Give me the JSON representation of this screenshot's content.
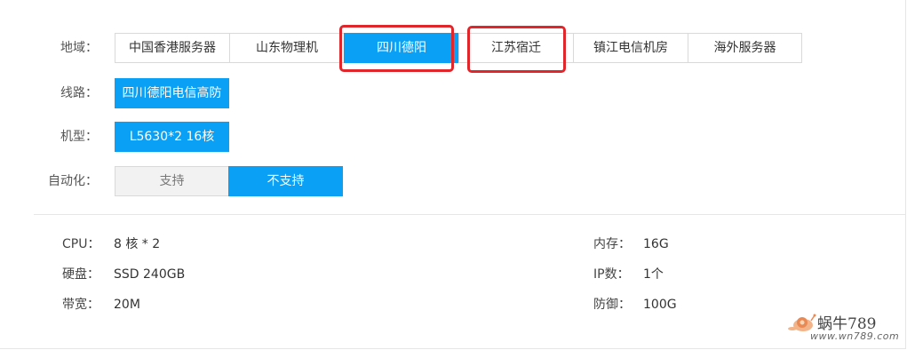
{
  "region": {
    "label": "地域：",
    "options": [
      {
        "text": "中国香港服务器",
        "state": "normal"
      },
      {
        "text": "山东物理机",
        "state": "normal"
      },
      {
        "text": "四川德阳",
        "state": "active"
      },
      {
        "text": "江苏宿迁",
        "state": "normal"
      },
      {
        "text": "镇江电信机房",
        "state": "normal"
      },
      {
        "text": "海外服务器",
        "state": "normal"
      }
    ]
  },
  "line": {
    "label": "线路：",
    "options": [
      {
        "text": "四川德阳电信高防",
        "state": "active"
      }
    ]
  },
  "model": {
    "label": "机型：",
    "options": [
      {
        "text": "L5630*2 16核",
        "state": "active"
      }
    ]
  },
  "automation": {
    "label": "自动化：",
    "options": [
      {
        "text": "支持",
        "state": "disabled"
      },
      {
        "text": "不支持",
        "state": "active"
      }
    ]
  },
  "specs": {
    "cpu_label": "CPU：",
    "cpu_value": "8 核 * 2",
    "disk_label": "硬盘：",
    "disk_value": "SSD 240GB",
    "bandwidth_label": "带宽：",
    "bandwidth_value": "20M",
    "memory_label": "内存：",
    "memory_value": "16G",
    "ip_label": "IP数：",
    "ip_value": "1个",
    "defense_label": "防御：",
    "defense_value": "100G"
  },
  "watermark": {
    "brand": "蜗牛789",
    "url": "www.wn789.com"
  },
  "colors": {
    "active": "#0aa0f5",
    "highlight": "#e0262b"
  }
}
